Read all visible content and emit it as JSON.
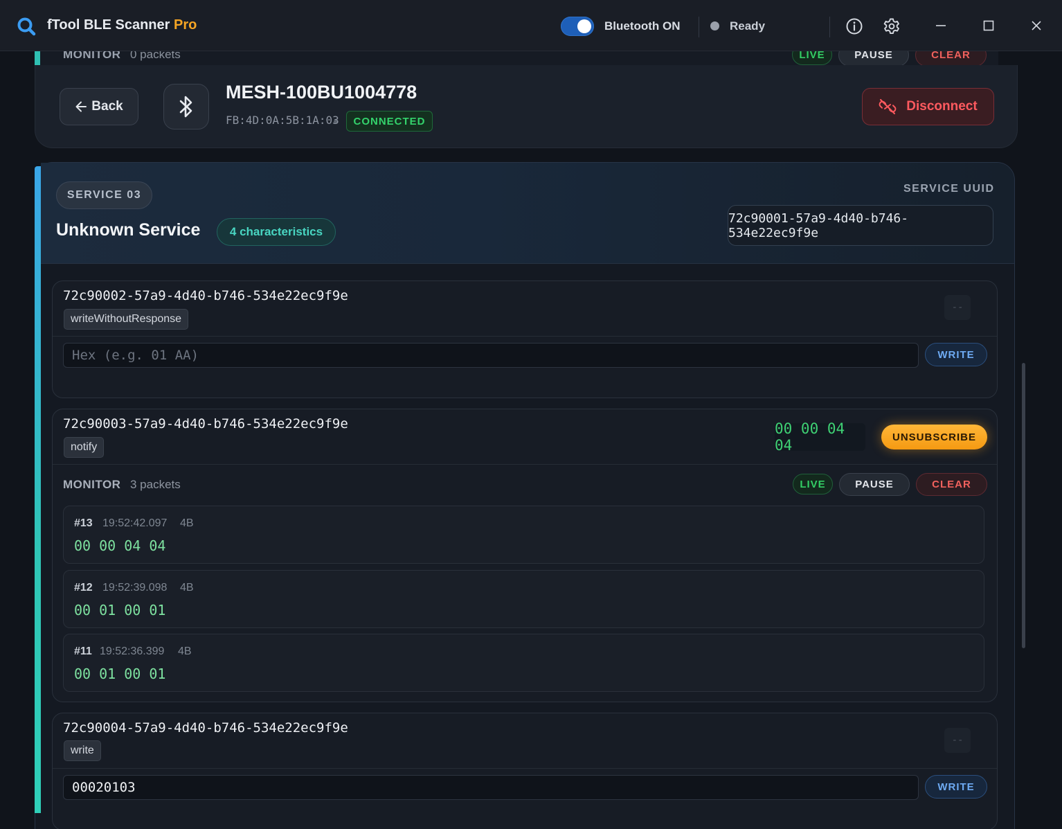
{
  "app": {
    "title": "fTool BLE Scanner",
    "title_suffix": "Pro",
    "bluetooth_label": "Bluetooth ON",
    "bluetooth_on": true,
    "status_label": "Ready",
    "accent": "#f5a524"
  },
  "sticky_monitor": {
    "label": "MONITOR",
    "count": "0 packets",
    "live": "LIVE",
    "pause": "PAUSE",
    "clear": "CLEAR"
  },
  "device": {
    "back_label": "Back",
    "name": "MESH-100BU1004778",
    "mac": "FB:4D:0A:5B:1A:03",
    "status": "CONNECTED",
    "disconnect_label": "Disconnect"
  },
  "service": {
    "number": "SERVICE 03",
    "name": "Unknown Service",
    "characteristic_count": "4 characteristics",
    "uuid_label": "SERVICE UUID",
    "uuid": "72c90001-57a9-4d40-b746-534e22ec9f9e"
  },
  "characteristics": [
    {
      "uuid": "72c90002-57a9-4d40-b746-534e22ec9f9e",
      "property": "writeWithoutResponse",
      "value": "--",
      "input_placeholder": "Hex (e.g. 01 AA)",
      "input_value": "",
      "write_label": "WRITE"
    },
    {
      "uuid": "72c90003-57a9-4d40-b746-534e22ec9f9e",
      "property": "notify",
      "value": "00 00 04 04",
      "action_label": "UNSUBSCRIBE",
      "monitor": {
        "label": "MONITOR",
        "count": "3 packets",
        "live": "LIVE",
        "pause": "PAUSE",
        "clear": "CLEAR",
        "packets": [
          {
            "seq": "#13",
            "time": "19:52:42.097",
            "size": "4B",
            "data": "00 00 04 04"
          },
          {
            "seq": "#12",
            "time": "19:52:39.098",
            "size": "4B",
            "data": "00 01 00 01"
          },
          {
            "seq": "#11",
            "time": "19:52:36.399",
            "size": "4B",
            "data": "00 01 00 01"
          }
        ]
      }
    },
    {
      "uuid": "72c90004-57a9-4d40-b746-534e22ec9f9e",
      "property": "write",
      "value": "--",
      "input_value": "00020103",
      "write_label": "WRITE"
    }
  ]
}
